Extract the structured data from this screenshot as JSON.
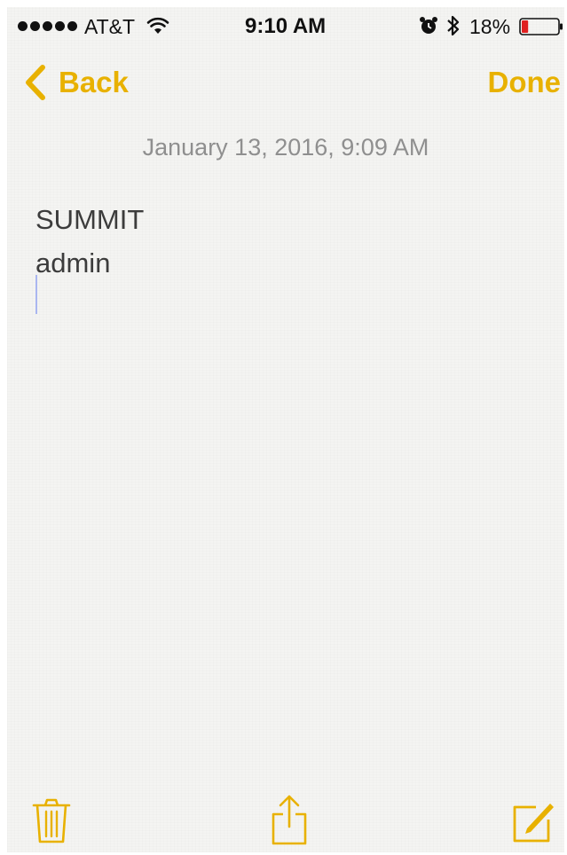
{
  "status_bar": {
    "carrier": "AT&T",
    "time": "9:10 AM",
    "battery_percent": "18%",
    "signal_bars": 5,
    "battery_level": 0.18,
    "icons": [
      "wifi-icon",
      "alarm-icon",
      "bluetooth-icon",
      "battery-icon"
    ]
  },
  "nav": {
    "back_label": "Back",
    "done_label": "Done",
    "back_icon": "chevron-left-icon"
  },
  "note": {
    "date": "January 13, 2016, 9:09 AM",
    "lines": [
      "SUMMIT",
      "admin"
    ]
  },
  "toolbar": {
    "icons": [
      "trash-icon",
      "share-icon",
      "compose-icon"
    ]
  },
  "colors": {
    "accent": "#e8b100",
    "text": "#3c3c3c",
    "date_text": "#8f8f8f",
    "background": "#f4f4f2",
    "battery_low": "#e02020"
  }
}
